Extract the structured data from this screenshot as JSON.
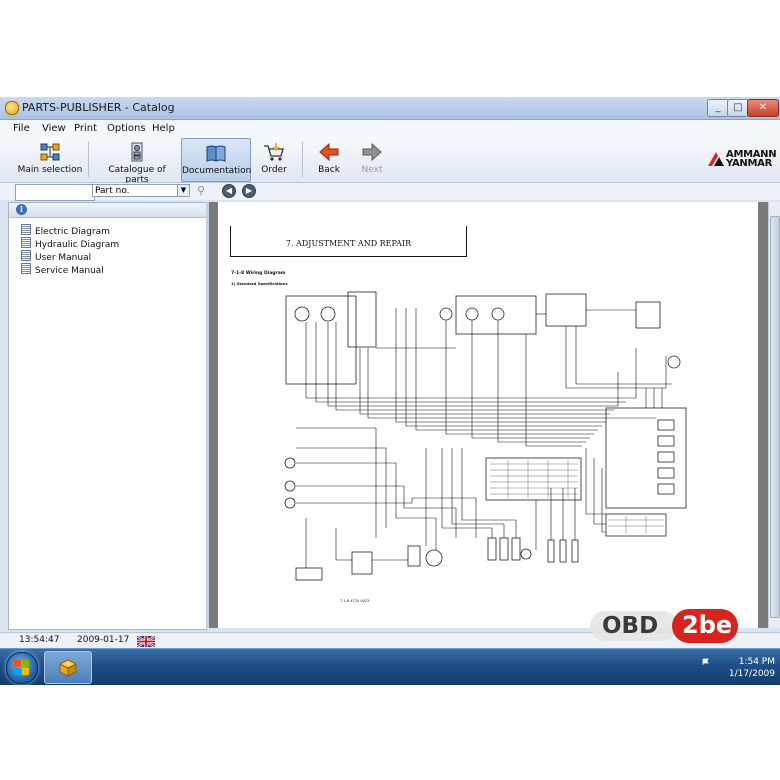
{
  "window": {
    "title": "PARTS-PUBLISHER - Catalog",
    "controls": {
      "minimize": "_",
      "maximize": "□",
      "close": "✕"
    }
  },
  "menu": [
    "File",
    "View",
    "Print",
    "Options",
    "Help"
  ],
  "toolbar": {
    "buttons": [
      {
        "label": "Main selection",
        "icon": "main-selection-icon"
      },
      {
        "label": "Catalogue of parts",
        "icon": "catalogue-icon"
      },
      {
        "label": "Documentation",
        "icon": "book-icon",
        "active": true
      },
      {
        "label": "Order",
        "icon": "cart-icon"
      },
      {
        "label": "Back",
        "icon": "back-arrow-icon"
      },
      {
        "label": "Next",
        "icon": "next-arrow-icon",
        "disabled": true
      }
    ],
    "brand": {
      "line1": "AMMANN",
      "line2": "YANMAR"
    }
  },
  "search": {
    "field_value": "",
    "select_value": "Part no."
  },
  "left_panel": {
    "items": [
      "Electric Diagram",
      "Hydraulic Diagram",
      "User Manual",
      "Service Manual"
    ]
  },
  "document": {
    "heading": "7. ADJUSTMENT AND REPAIR",
    "section": "7-1-8  Wiring Diagram",
    "subsection": "1)  Standard Specifications",
    "footer": "7-1-8          4720 0023"
  },
  "status": {
    "time": "13:54:47",
    "date": "2009-01-17",
    "language_flag": "uk-flag-icon"
  },
  "watermark": {
    "left": "OBD",
    "right": "2be"
  },
  "taskbar": {
    "clock_time": "1:54 PM",
    "clock_date": "1/17/2009"
  },
  "colors": {
    "title_bar": "#a9c2e3",
    "close_button": "#c6412a",
    "taskbar": "#1e4f86",
    "watermark_red": "#d6251f"
  }
}
